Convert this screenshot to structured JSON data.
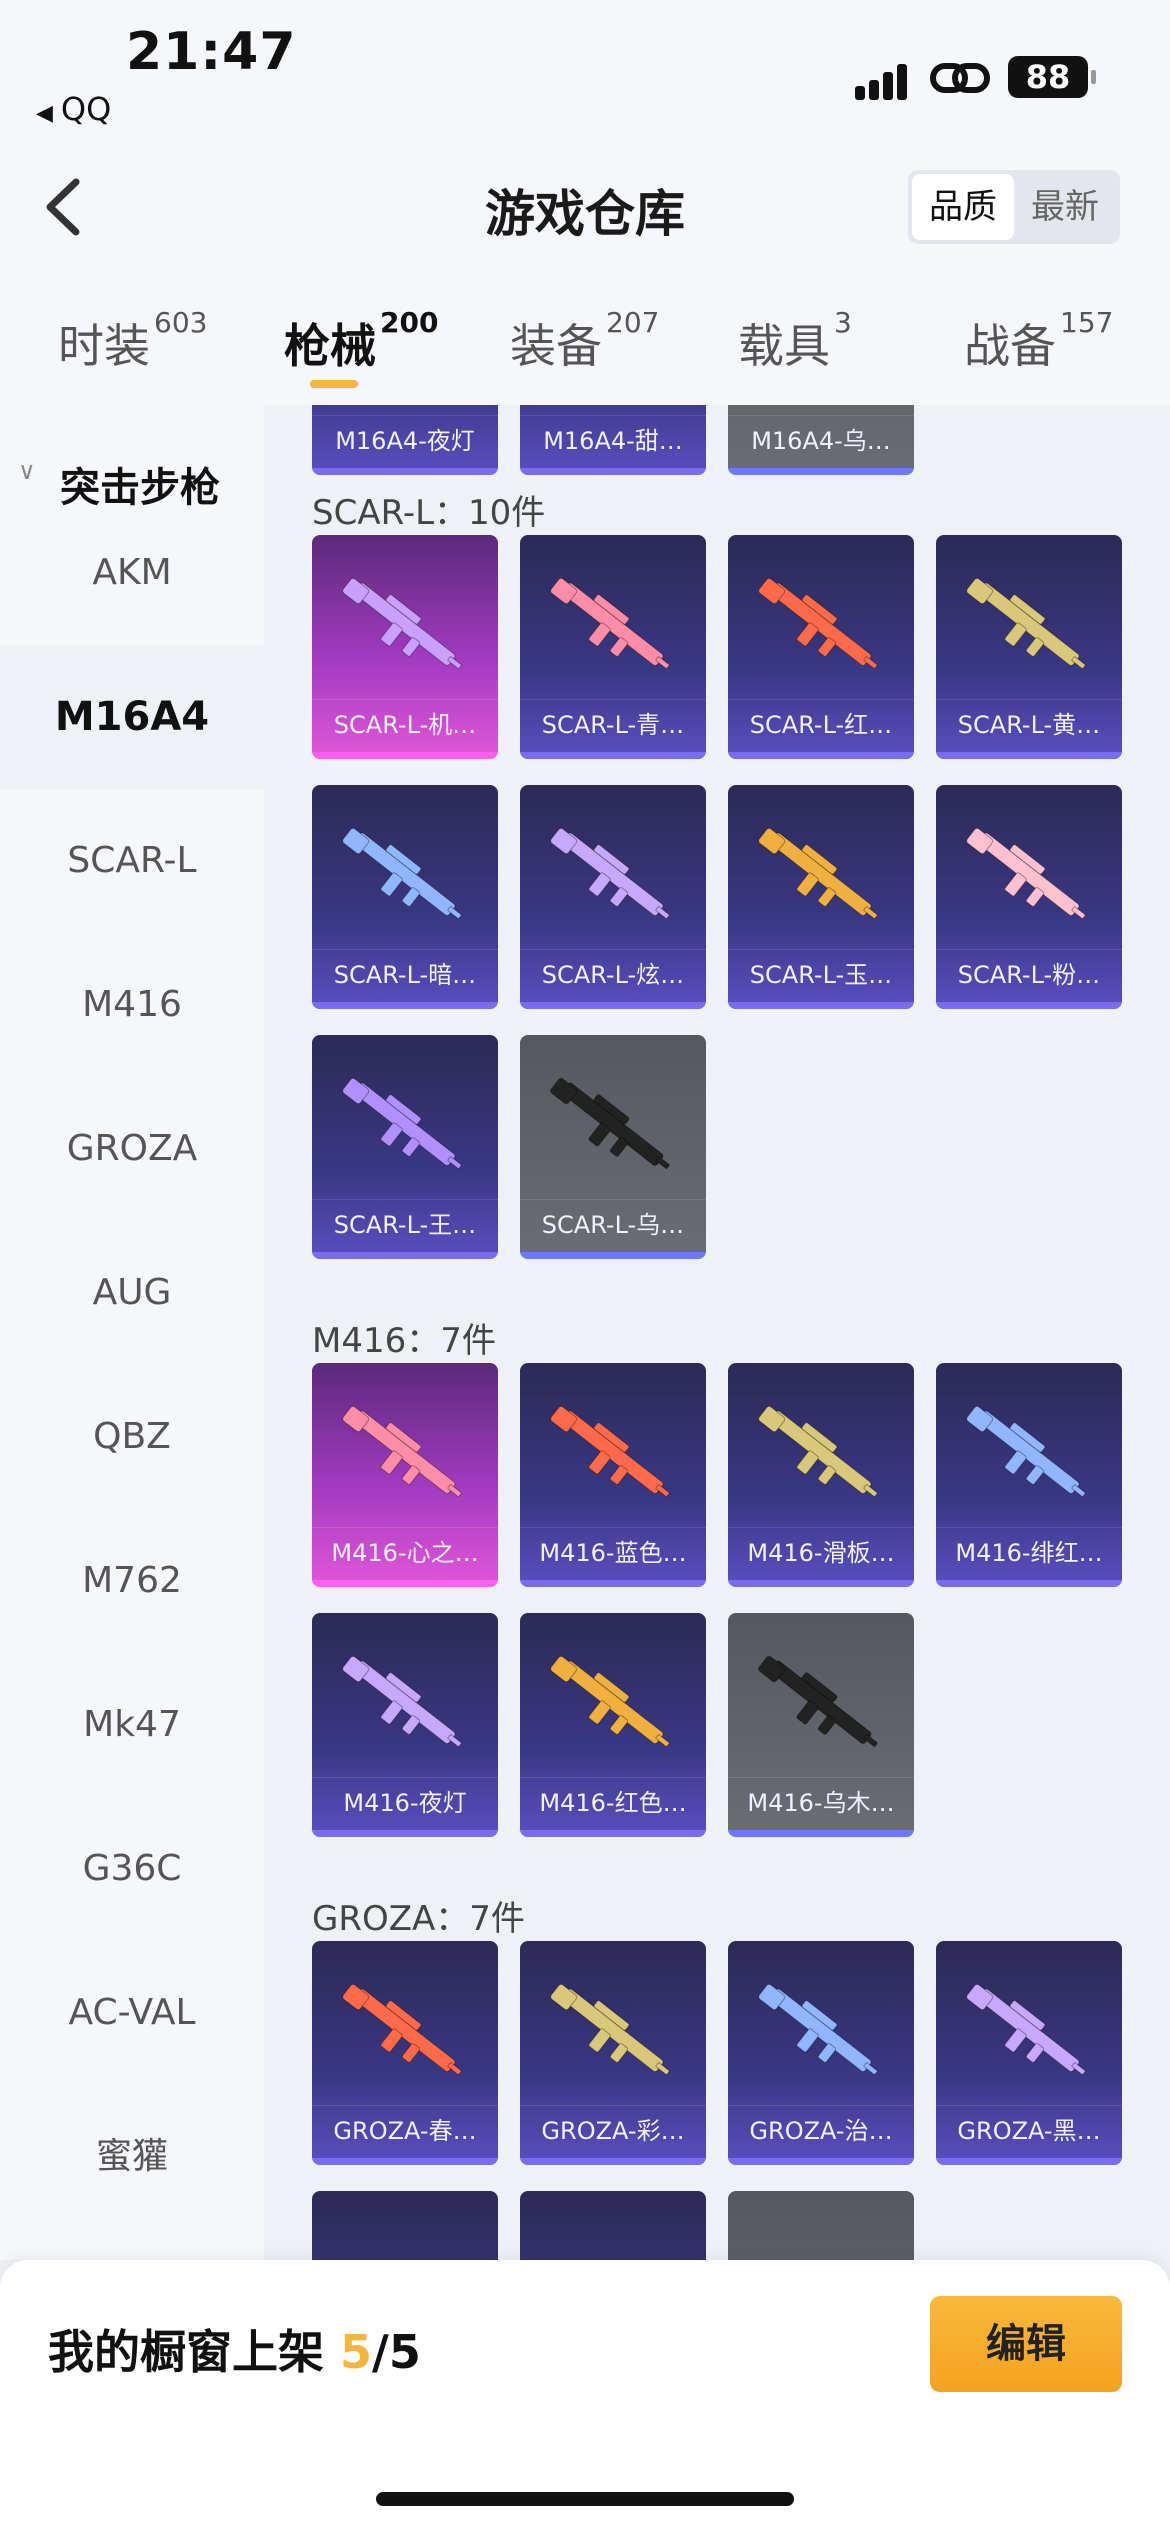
{
  "status_bar": {
    "time": "21:47",
    "back_app": "QQ",
    "battery": "88",
    "icons": [
      "signal-icon",
      "link-icon",
      "battery-icon"
    ]
  },
  "header": {
    "title": "游戏仓库",
    "sort_options": [
      "品质",
      "最新"
    ],
    "sort_active": "品质"
  },
  "tabs": [
    {
      "label": "时装",
      "count": "603"
    },
    {
      "label": "枪械",
      "count": "200"
    },
    {
      "label": "装备",
      "count": "207"
    },
    {
      "label": "载具",
      "count": "3"
    },
    {
      "label": "战备",
      "count": "157"
    }
  ],
  "active_tab": "枪械",
  "sidebar": {
    "category": "突击步枪",
    "items": [
      "AKM",
      "M16A4",
      "SCAR-L",
      "M416",
      "GROZA",
      "AUG",
      "QBZ",
      "M762",
      "Mk47",
      "G36C",
      "AC-VAL",
      "蜜獾"
    ],
    "active": "M16A4"
  },
  "content": {
    "m16a4_partial": [
      {
        "name": "M16A4-夜灯",
        "rarity": "epic"
      },
      {
        "name": "M16A4-甜…",
        "rarity": "epic"
      },
      {
        "name": "M16A4-乌…",
        "rarity": "common"
      }
    ],
    "sections": [
      {
        "title": "SCAR-L：10件",
        "items": [
          {
            "name": "SCAR-L-机…",
            "rarity": "legend"
          },
          {
            "name": "SCAR-L-青…",
            "rarity": "epic"
          },
          {
            "name": "SCAR-L-红…",
            "rarity": "epic"
          },
          {
            "name": "SCAR-L-黄…",
            "rarity": "epic"
          },
          {
            "name": "SCAR-L-暗…",
            "rarity": "epic"
          },
          {
            "name": "SCAR-L-炫…",
            "rarity": "epic"
          },
          {
            "name": "SCAR-L-玉…",
            "rarity": "epic"
          },
          {
            "name": "SCAR-L-粉…",
            "rarity": "epic"
          },
          {
            "name": "SCAR-L-王…",
            "rarity": "epic"
          },
          {
            "name": "SCAR-L-乌…",
            "rarity": "common"
          }
        ]
      },
      {
        "title": "M416：7件",
        "items": [
          {
            "name": "M416-心之…",
            "rarity": "legend"
          },
          {
            "name": "M416-蓝色…",
            "rarity": "epic"
          },
          {
            "name": "M416-滑板…",
            "rarity": "epic"
          },
          {
            "name": "M416-绯红…",
            "rarity": "epic"
          },
          {
            "name": "M416-夜灯",
            "rarity": "epic"
          },
          {
            "name": "M416-红色…",
            "rarity": "epic"
          },
          {
            "name": "M416-乌木…",
            "rarity": "common"
          }
        ]
      },
      {
        "title": "GROZA：7件",
        "items": [
          {
            "name": "GROZA-春…",
            "rarity": "epic"
          },
          {
            "name": "GROZA-彩…",
            "rarity": "epic"
          },
          {
            "name": "GROZA-治…",
            "rarity": "epic"
          },
          {
            "name": "GROZA-黑…",
            "rarity": "epic"
          }
        ]
      }
    ]
  },
  "bottom_bar": {
    "label": "我的橱窗上架",
    "current": "5",
    "total": "/5",
    "edit_label": "编辑"
  },
  "colors": {
    "accent": "#f3b53c",
    "epic_card": "#3a3784",
    "legend_card": "#a23ac0",
    "common_card": "#6a6d74"
  }
}
